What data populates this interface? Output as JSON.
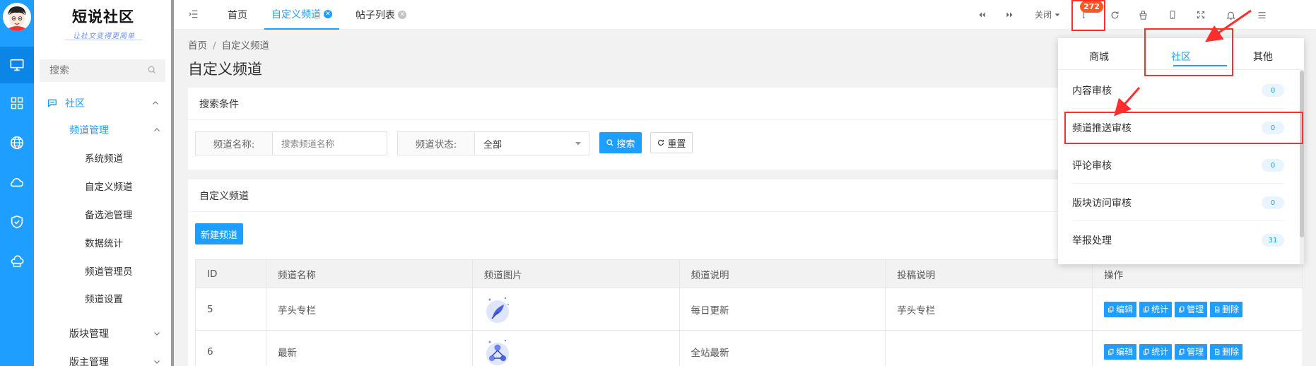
{
  "app": {
    "logo_title": "短说社区",
    "logo_subtitle": "让社交变得更简单"
  },
  "rail": {
    "items": [
      "monitor-icon",
      "apps-grid-icon",
      "globe-icon",
      "cloud-icon",
      "shield-check-icon",
      "cloud-server-icon"
    ]
  },
  "sidebar": {
    "search_placeholder": "搜索",
    "menu": {
      "community": "社区",
      "channel_mgmt": "频道管理",
      "children": [
        "系统频道",
        "自定义频道",
        "备选池管理",
        "数据统计",
        "频道管理员",
        "频道设置"
      ],
      "board_mgmt": "版块管理",
      "moderator_mgmt": "版主管理"
    }
  },
  "topbar": {
    "tabs": [
      {
        "label": "首页"
      },
      {
        "label": "自定义频道",
        "closable": true
      },
      {
        "label": "帖子列表",
        "closable": true
      }
    ],
    "close_label": "关闭",
    "notify_count": "272"
  },
  "breadcrumb": {
    "home": "首页",
    "sep": "/",
    "current": "自定义频道"
  },
  "page_title": "自定义频道",
  "search_panel": {
    "title": "搜索条件",
    "name_label": "频道名称:",
    "name_placeholder": "搜索频道名称",
    "status_label": "频道状态:",
    "status_value": "全部",
    "search_btn": "搜索",
    "reset_btn": "重置"
  },
  "list_panel": {
    "title": "自定义频道",
    "new_btn": "新建频道",
    "columns": [
      "ID",
      "频道名称",
      "频道图片",
      "频道说明",
      "投稿说明",
      "操作"
    ],
    "rows": [
      {
        "id": "5",
        "name": "芋头专栏",
        "desc": "每日更新",
        "submit_desc": "芋头专栏"
      },
      {
        "id": "6",
        "name": "最新",
        "desc": "全站最新",
        "submit_desc": ""
      }
    ],
    "actions": [
      "编辑",
      "统计",
      "管理",
      "删除"
    ]
  },
  "notify_popup": {
    "tabs": [
      "商城",
      "社区",
      "其他"
    ],
    "active_tab": "社区",
    "items": [
      {
        "label": "内容审核",
        "count": "0"
      },
      {
        "label": "频道推送审核",
        "count": "0"
      },
      {
        "label": "评论审核",
        "count": "0"
      },
      {
        "label": "版块访问审核",
        "count": "0"
      },
      {
        "label": "举报处理",
        "count": "31"
      }
    ]
  },
  "colors": {
    "primary": "#1E9FFF",
    "badge": "#FF5722",
    "highlight": "#FF2D2D"
  }
}
